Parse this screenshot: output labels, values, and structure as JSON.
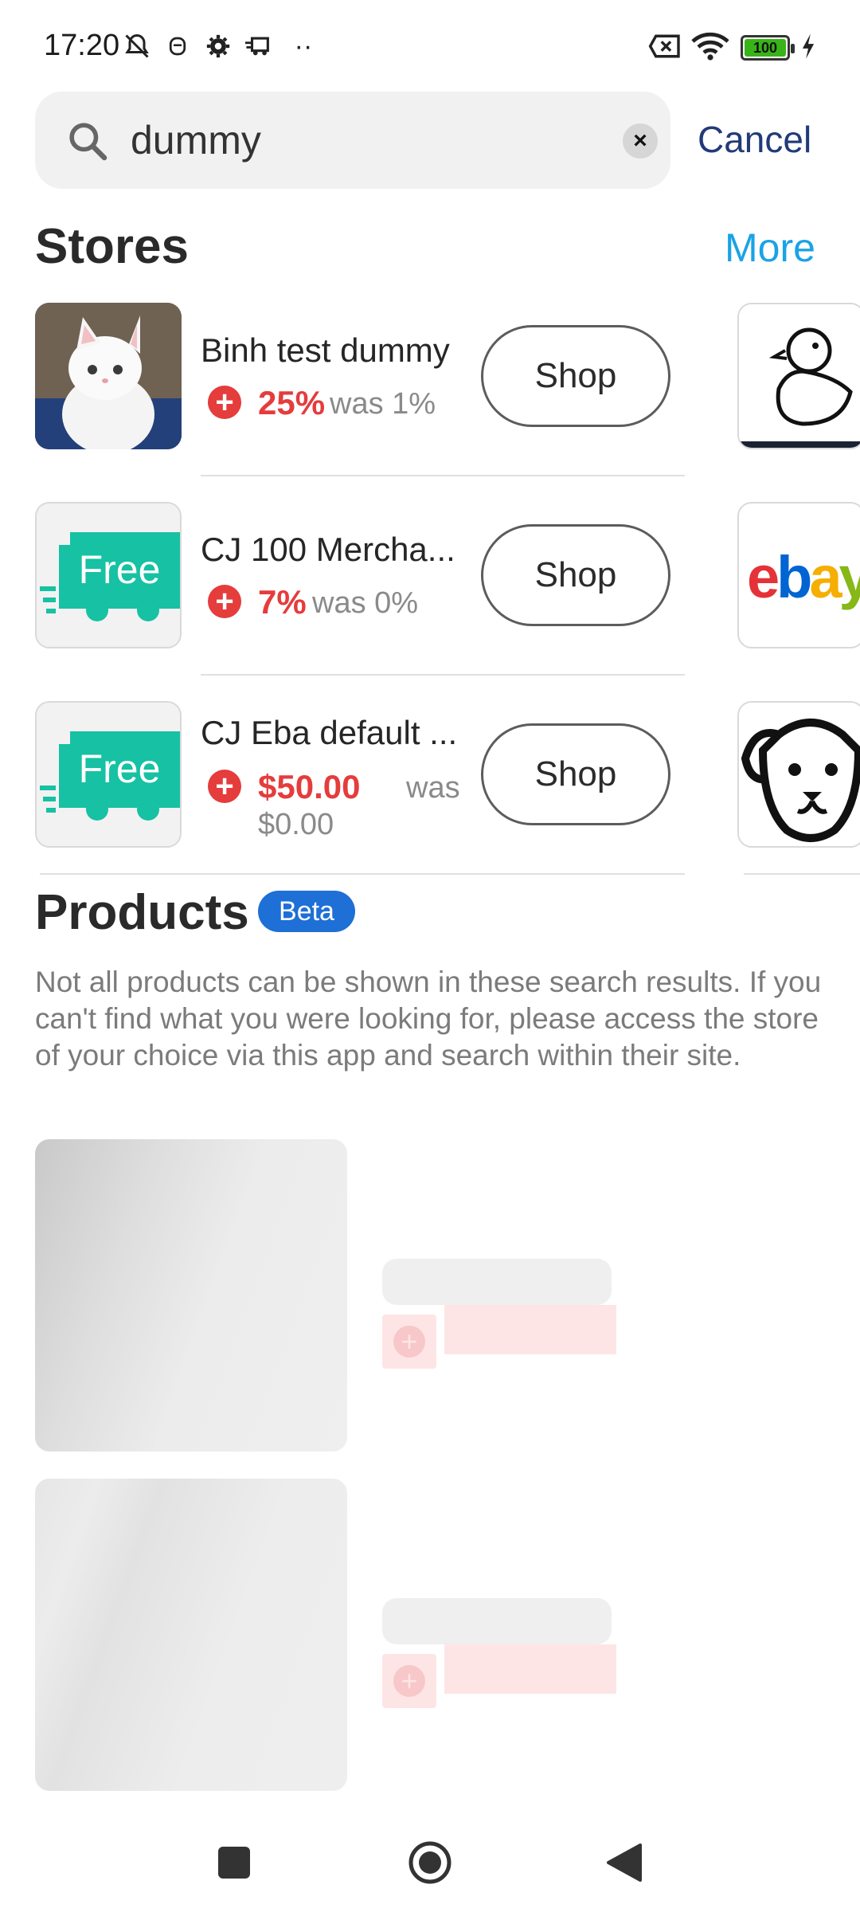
{
  "status_bar": {
    "time": "17:20",
    "battery": "100"
  },
  "search": {
    "value": "dummy",
    "placeholder": "",
    "cancel_label": "Cancel"
  },
  "stores_section": {
    "title": "Stores",
    "more_label": "More",
    "items": [
      {
        "name": "Binh test dummy",
        "cashback": "25%",
        "was": "was 1%",
        "shop_label": "Shop"
      },
      {
        "name": "CJ 100 Mercha...",
        "cashback": "7%",
        "was": "was 0%",
        "shop_label": "Shop"
      },
      {
        "name": "CJ Eba default ...",
        "cashback": "$50.00",
        "was_word": "was",
        "was_value": "$0.00",
        "shop_label": "Shop"
      }
    ],
    "side_logo_text": "ebay",
    "thumb_text": "Free"
  },
  "products_section": {
    "title": "Products",
    "badge": "Beta",
    "notice": "Not all products can be shown in these search results. If you can't find what you were looking for, please access the store of your choice via this app and search within their site."
  },
  "colors": {
    "accent_red": "#e53c3c",
    "link_blue": "#19a3e6",
    "cancel_navy": "#223a7a",
    "beta_blue": "#1e6fd6",
    "free_teal": "#17c1a3"
  }
}
